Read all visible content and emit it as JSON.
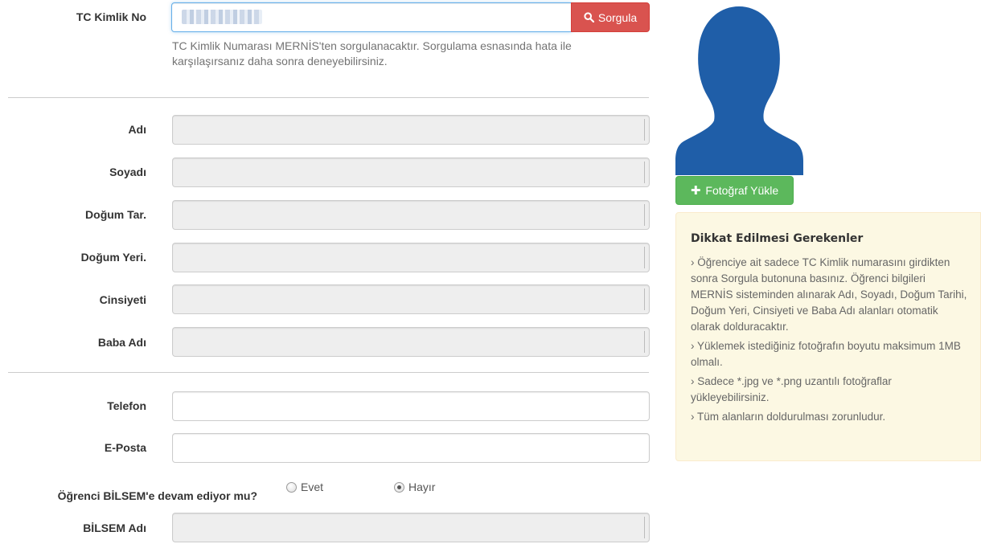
{
  "identity": {
    "tc_label": "TC Kimlik No",
    "sorgula_label": "Sorgula",
    "help_text": "TC Kimlik Numarası MERNİS'ten sorgulanacaktır. Sorgulama esnasında hata ile karşılaşırsanız daha sonra deneyebilirsiniz."
  },
  "fields": {
    "adi": "Adı",
    "soyadi": "Soyadı",
    "dogum_tar": "Doğum Tar.",
    "dogum_yeri": "Doğum Yeri.",
    "cinsiyeti": "Cinsiyeti",
    "baba_adi": "Baba Adı",
    "telefon": "Telefon",
    "eposta": "E-Posta",
    "bilsem_adi": "BİLSEM Adı"
  },
  "bilsem": {
    "question": "Öğrenci BİLSEM'e devam ediyor mu?",
    "options": [
      "Evet",
      "Hayır"
    ],
    "selected": "Hayır"
  },
  "photo": {
    "upload_label": "Fotoğraf Yükle"
  },
  "notice": {
    "title": "Dikkat Edilmesi Gerekenler",
    "items": [
      "› Öğrenciye ait sadece TC Kimlik numarasını girdikten sonra Sorgula butonuna basınız. Öğrenci bilgileri MERNİS sisteminden alınarak Adı, Soyadı, Doğum Tarihi, Doğum Yeri, Cinsiyeti ve Baba Adı alanları otomatik olarak dolduracaktır.",
      "› Yüklemek istediğiniz fotoğrafın boyutu maksimum 1MB olmalı.",
      "› Sadece *.jpg ve *.png uzantılı fotoğraflar yükleyebilirsiniz.",
      "› Tüm alanların doldurulması zorunludur."
    ]
  },
  "colors": {
    "danger": "#d9534f",
    "success": "#5cb85c",
    "avatar": "#1f5ea8",
    "notice_bg": "#fcf8e3"
  },
  "icons": {
    "search": "search-icon",
    "plus": "plus-icon",
    "avatar": "person-silhouette-icon"
  }
}
